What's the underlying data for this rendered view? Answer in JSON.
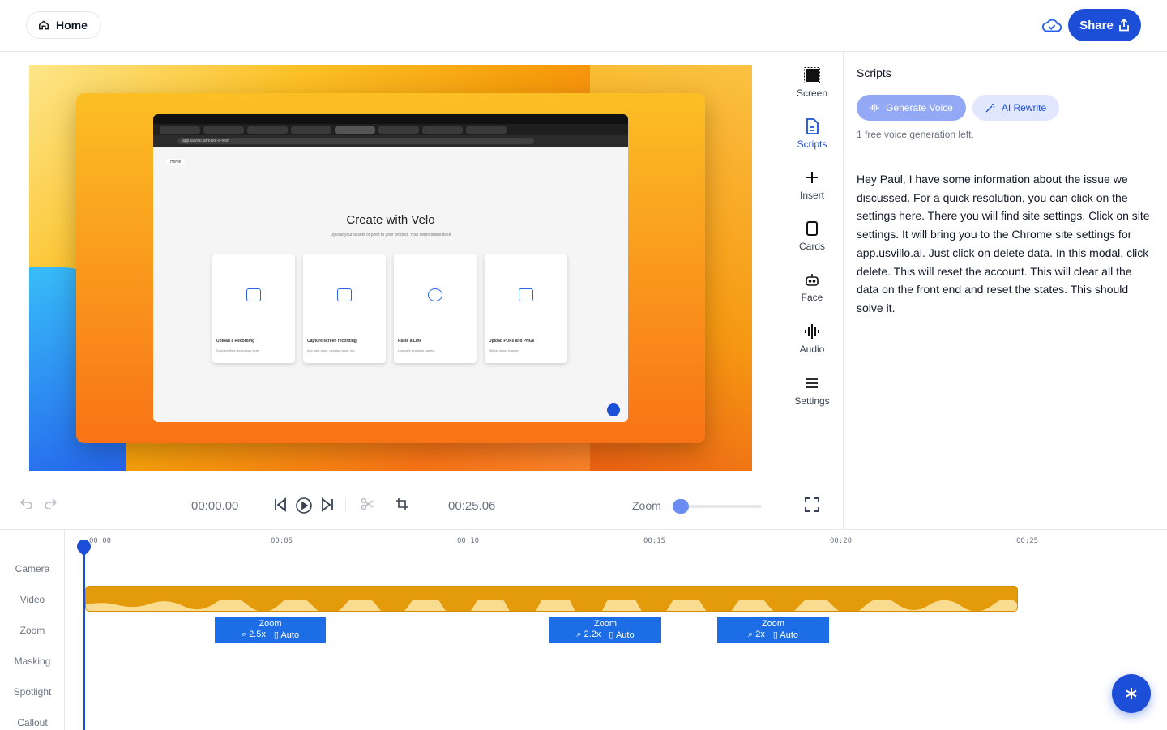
{
  "header": {
    "home_label": "Home",
    "share_label": "Share"
  },
  "preview": {
    "browser_title": "Create with Velo",
    "browser_subtitle": "Upload your assets or point to your product. Your demo builds itself",
    "home_chip": "Home",
    "url": "app.usvillo.ai/make-a-velo",
    "cards": [
      {
        "label": "Upload a Recording",
        "sub": "Drop existing recordings here"
      },
      {
        "label": "Capture screen recording",
        "sub": "Any web apps, desktop tools, etc"
      },
      {
        "label": "Paste a Link",
        "sub": "Live web products pages"
      },
      {
        "label": "Upload PDFs and PNGs",
        "sub": "Slides, docs, images"
      }
    ]
  },
  "tools": [
    {
      "label": "Screen",
      "icon": "screen-icon"
    },
    {
      "label": "Scripts",
      "icon": "document-icon"
    },
    {
      "label": "Insert",
      "icon": "plus-icon"
    },
    {
      "label": "Cards",
      "icon": "card-icon"
    },
    {
      "label": "Face",
      "icon": "robot-face-icon"
    },
    {
      "label": "Audio",
      "icon": "waveform-icon"
    },
    {
      "label": "Settings",
      "icon": "menu-lines-icon"
    }
  ],
  "scripts_panel": {
    "title": "Scripts",
    "generate_voice": "Generate Voice",
    "ai_rewrite": "AI Rewrite",
    "free_note": "1 free voice generation left.",
    "script": "Hey Paul, I have some information about the issue we discussed.  For a quick resolution, you can click on the settings here.  There you will find site settings.  Click on site settings.  It will bring you to the Chrome site settings for app.usvillo.ai.  Just click on delete data.  In this modal, click delete.  This will reset the account.  This will clear all the data on the front end and reset the states.  This should solve it."
  },
  "controls": {
    "current_time": "00:00.00",
    "total_time": "00:25.06",
    "zoom_label": "Zoom",
    "zoom_level": 0
  },
  "timeline": {
    "tracks": [
      "Camera",
      "Video",
      "Zoom",
      "Masking",
      "Spotlight",
      "Callout"
    ],
    "ticks": [
      "00:00",
      "00:05",
      "00:10",
      "00:15",
      "00:20",
      "00:25"
    ],
    "zooms": [
      {
        "title": "Zoom",
        "level": "2.5x",
        "mode": "Auto"
      },
      {
        "title": "Zoom",
        "level": "2.2x",
        "mode": "Auto"
      },
      {
        "title": "Zoom",
        "level": "2x",
        "mode": "Auto"
      }
    ]
  },
  "colors": {
    "accent": "#1d4ed8",
    "clip": "#e39b0b"
  }
}
